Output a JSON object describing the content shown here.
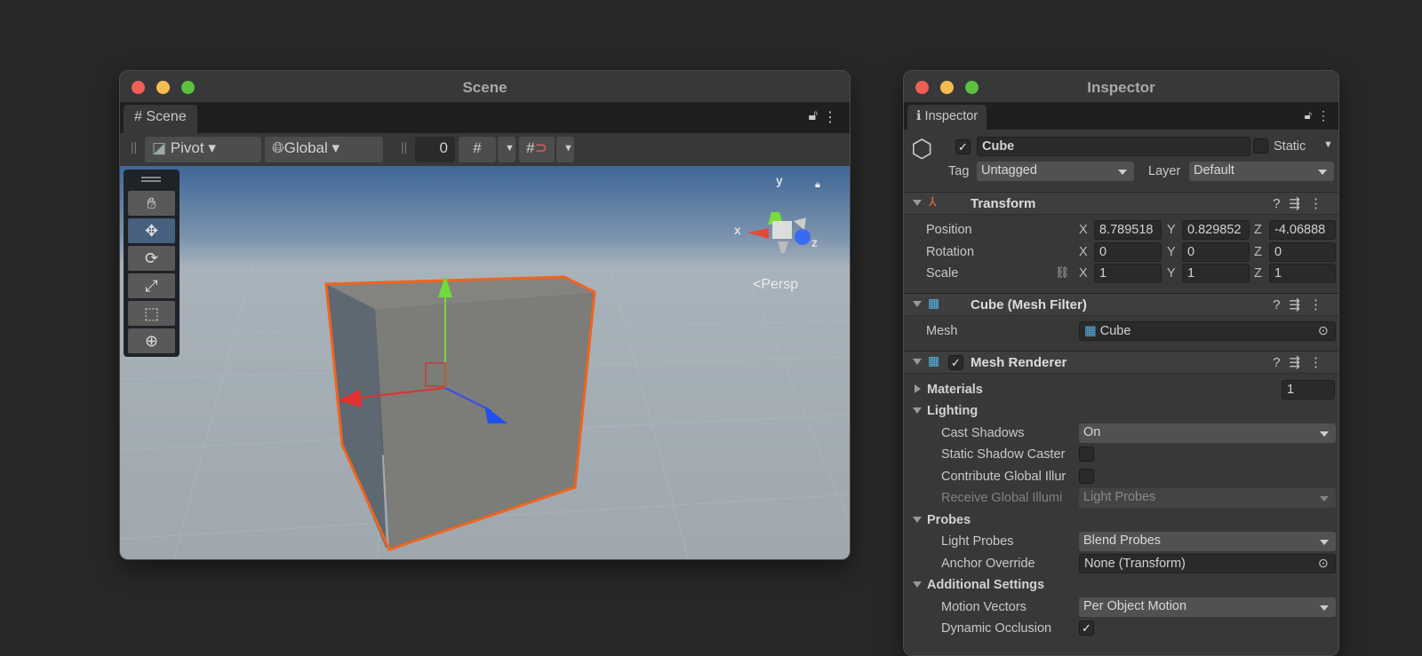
{
  "scene": {
    "title": "Scene",
    "tab": "Scene",
    "pivot": "Pivot",
    "global": "Global",
    "grid_value": "0",
    "persp": "<Persp",
    "gizmo": {
      "x": "x",
      "y": "y",
      "z": "z"
    }
  },
  "inspector": {
    "title": "Inspector",
    "tab": "Inspector",
    "object_name": "Cube",
    "static": "Static",
    "tag_label": "Tag",
    "tag": "Untagged",
    "layer_label": "Layer",
    "layer": "Default",
    "transform": {
      "title": "Transform",
      "position_label": "Position",
      "rotation_label": "Rotation",
      "scale_label": "Scale",
      "position": {
        "x": "8.789518",
        "y": "0.829852",
        "z": "-4.06888"
      },
      "rotation": {
        "x": "0",
        "y": "0",
        "z": "0"
      },
      "scale": {
        "x": "1",
        "y": "1",
        "z": "1"
      },
      "ax": {
        "x": "X",
        "y": "Y",
        "z": "Z"
      }
    },
    "mesh_filter": {
      "title": "Cube (Mesh Filter)",
      "mesh_label": "Mesh",
      "mesh": "Cube"
    },
    "mesh_renderer": {
      "title": "Mesh Renderer",
      "materials": "Materials",
      "materials_count": "1",
      "lighting": "Lighting",
      "cast_shadows_label": "Cast Shadows",
      "cast_shadows": "On",
      "static_shadow": "Static Shadow Caster",
      "contribute_gi": "Contribute Global Illur",
      "receive_gi_label": "Receive Global Illumi",
      "receive_gi": "Light Probes",
      "probes": "Probes",
      "light_probes_label": "Light Probes",
      "light_probes": "Blend Probes",
      "anchor_label": "Anchor Override",
      "anchor": "None (Transform)",
      "additional": "Additional Settings",
      "motion_label": "Motion Vectors",
      "motion": "Per Object Motion",
      "dynamic_occlusion": "Dynamic Occlusion"
    }
  },
  "colors": {
    "close": "#ee5f57",
    "min": "#f5bd4f",
    "max": "#5ac13f",
    "selection": "#f0641e"
  }
}
